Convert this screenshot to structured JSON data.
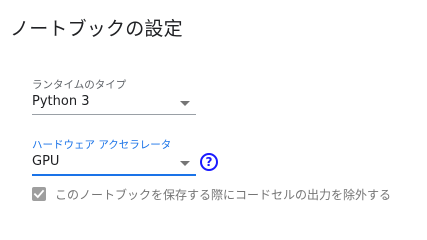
{
  "dialog": {
    "title": "ノートブックの設定"
  },
  "runtime_type": {
    "label": "ランタイムのタイプ",
    "value": "Python 3"
  },
  "hardware_accelerator": {
    "label": "ハードウェア アクセラレータ",
    "value": "GPU",
    "help_icon": "question-mark-circle-icon",
    "help_glyph": "?"
  },
  "omit_output": {
    "label": "このノートブックを保存する際にコードセルの出力を除外する",
    "checked": true,
    "disabled": true
  },
  "colors": {
    "accent": "#1a73e8",
    "help_icon": "#1a1aff",
    "disabled_checkbox": "#9e9e9e"
  }
}
